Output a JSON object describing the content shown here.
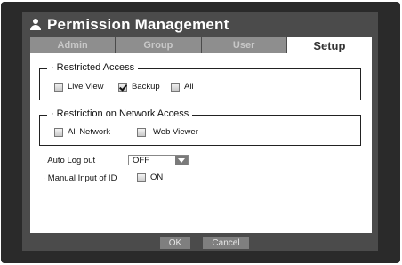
{
  "title": "Permission Management",
  "title_icon": "user-icon",
  "tabs": [
    {
      "label": "Admin",
      "active": false
    },
    {
      "label": "Group",
      "active": false
    },
    {
      "label": "User",
      "active": false
    },
    {
      "label": "Setup",
      "active": true
    }
  ],
  "restricted_access": {
    "legend_bullet": "·",
    "legend": "Restricted Access",
    "options": [
      {
        "label": "Live View",
        "checked": false
      },
      {
        "label": "Backup",
        "checked": true
      },
      {
        "label": "All",
        "checked": false
      }
    ]
  },
  "network_access": {
    "legend_bullet": "·",
    "legend": "Restriction on Network Access",
    "options": [
      {
        "label": "All Network",
        "checked": false
      },
      {
        "label": "Web Viewer",
        "checked": false
      }
    ]
  },
  "auto_logout": {
    "label": "· Auto Log out",
    "value": "OFF"
  },
  "manual_id": {
    "label": "· Manual Input of ID",
    "option_label": "ON",
    "checked": false
  },
  "buttons": {
    "ok": "OK",
    "cancel": "Cancel"
  },
  "colors": {
    "frame": "#2a2a2a",
    "window": "#4b4b4b",
    "tab_inactive": "#8e8e8e",
    "tab_active": "#ffffff",
    "button": "#7f7f7f"
  }
}
